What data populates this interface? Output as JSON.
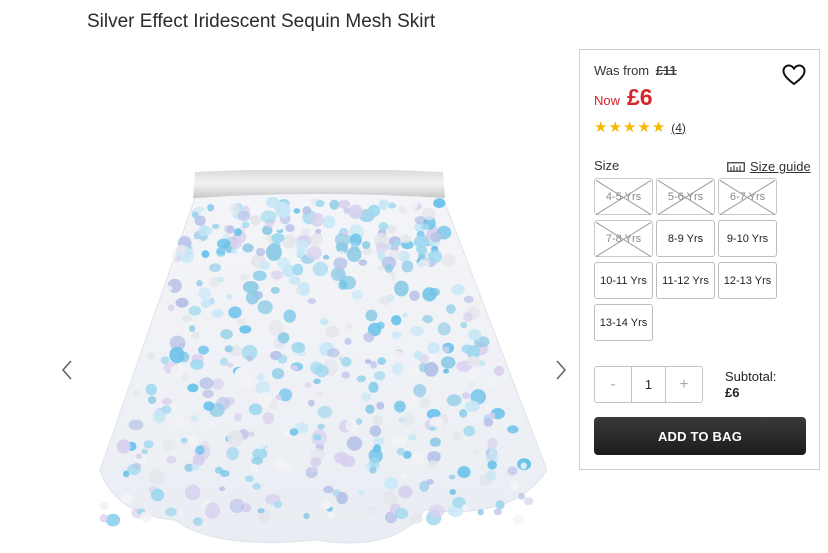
{
  "product": {
    "title": "Silver Effect Iridescent Sequin Mesh Skirt",
    "image_name": "sequin-skirt-image"
  },
  "carousel": {
    "prev_icon": "chevron-left-icon",
    "next_icon": "chevron-right-icon"
  },
  "pricing": {
    "was_label": "Was from",
    "was_price": "£11",
    "now_label": "Now",
    "now_price": "£6",
    "sale_color": "#d6262b"
  },
  "rating": {
    "stars": 5,
    "review_count": "(4)",
    "star_color": "#f5b800"
  },
  "wishlist": {
    "icon": "heart-icon"
  },
  "sizes": {
    "label": "Size",
    "guide_label": "Size guide",
    "guide_icon": "ruler-icon",
    "options": [
      {
        "label": "4-5 Yrs",
        "available": false
      },
      {
        "label": "5-6 Yrs",
        "available": false
      },
      {
        "label": "6-7 Yrs",
        "available": false
      },
      {
        "label": "7-8 Yrs",
        "available": false
      },
      {
        "label": "8-9 Yrs",
        "available": true
      },
      {
        "label": "9-10 Yrs",
        "available": true
      },
      {
        "label": "10-11 Yrs",
        "available": true
      },
      {
        "label": "11-12 Yrs",
        "available": true
      },
      {
        "label": "12-13 Yrs",
        "available": true
      },
      {
        "label": "13-14 Yrs",
        "available": true
      }
    ]
  },
  "quantity": {
    "decrement": "-",
    "value": "1",
    "increment": "+"
  },
  "subtotal": {
    "label": "Subtotal:",
    "value": "£6"
  },
  "cta": {
    "add_to_bag": "ADD TO BAG"
  }
}
